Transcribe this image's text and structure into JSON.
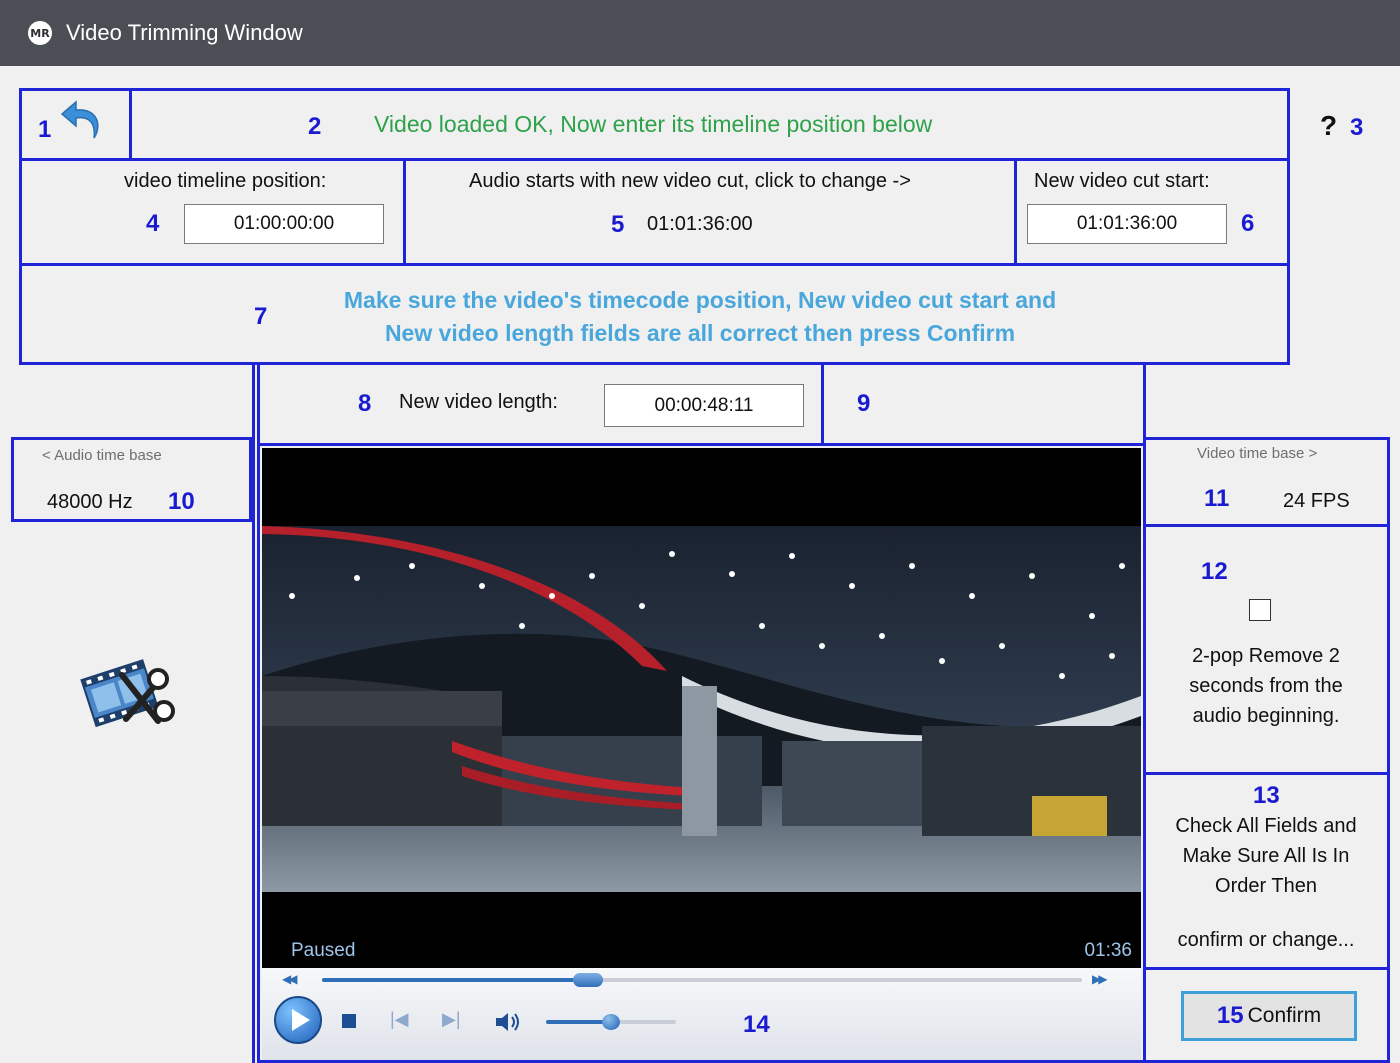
{
  "window": {
    "title": "Video Trimming Window",
    "logo_text": "MR"
  },
  "markers": {
    "m1": "1",
    "m2": "2",
    "m3": "3",
    "m4": "4",
    "m5": "5",
    "m6": "6",
    "m7": "7",
    "m8": "8",
    "m9": "9",
    "m10": "10",
    "m11": "11",
    "m12": "12",
    "m13": "13",
    "m14": "14",
    "m15": "15"
  },
  "status": {
    "message": "Video loaded OK, Now enter its timeline position below"
  },
  "help": {
    "glyph": "?"
  },
  "timeline": {
    "label": "video timeline position:",
    "value": "01:00:00:00"
  },
  "audio_start": {
    "label": "Audio starts with new video cut, click to change ->",
    "value": "01:01:36:00"
  },
  "cut_start": {
    "label": "New video cut start:",
    "value": "01:01:36:00"
  },
  "instructions": {
    "line1": "Make sure the video's timecode position, New video cut start and",
    "line2": "New video length fields are all correct then press Confirm"
  },
  "length": {
    "label": "New video length:",
    "value": "00:00:48:11"
  },
  "audio_base": {
    "label": "< Audio time base",
    "value": "48000 Hz"
  },
  "video_base": {
    "label": "Video time base >",
    "value": "24 FPS"
  },
  "two_pop": {
    "checked": false,
    "line1": "2-pop Remove 2",
    "line2": "seconds from the",
    "line3": "audio beginning."
  },
  "check_notice": {
    "line1": "Check All Fields and",
    "line2": "Make Sure All Is In",
    "line3": "Order Then",
    "line4": "confirm or change..."
  },
  "player": {
    "state": "Paused",
    "time": "01:36",
    "seek_progress": 0.35,
    "volume": 0.5
  },
  "confirm": {
    "label": "Confirm"
  },
  "colors": {
    "marker_blue": "#1a1ad0",
    "status_green": "#2ea24a",
    "instruction_blue": "#4aa7dc",
    "confirm_border": "#3fa0d8"
  },
  "icons": [
    "undo-arrow-icon",
    "help-icon",
    "film-scissors-icon",
    "play-icon",
    "stop-icon",
    "previous-icon",
    "next-icon",
    "volume-icon",
    "rewind-icon",
    "fast-forward-icon"
  ]
}
